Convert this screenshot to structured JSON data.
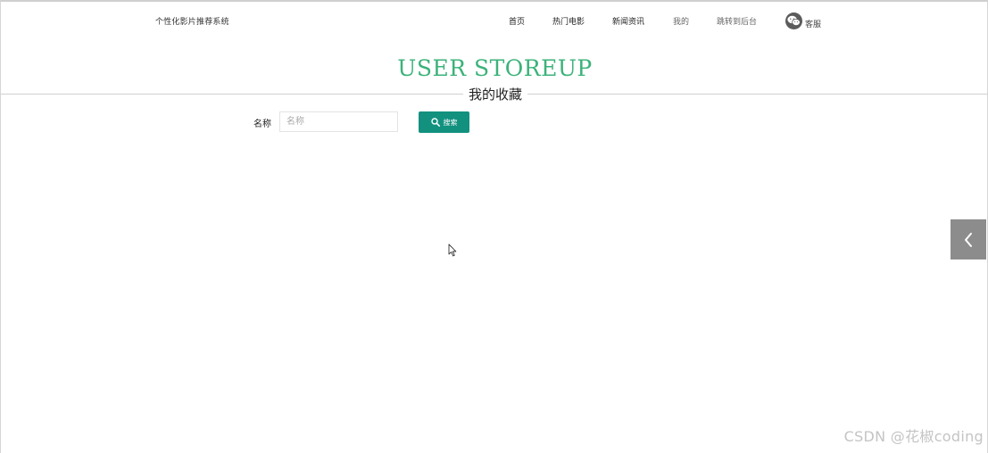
{
  "header": {
    "site_name": "个性化影片推荐系统",
    "nav": [
      {
        "label": "首页"
      },
      {
        "label": "热门电影"
      },
      {
        "label": "新闻资讯"
      },
      {
        "label": "我的"
      },
      {
        "label": "跳转到后台"
      }
    ],
    "service_label": "客服",
    "service_icon": "wechat-icon"
  },
  "main": {
    "title": "USER STOREUP",
    "subtitle": "我的收藏",
    "title_color": "#3bb27a",
    "search": {
      "label": "名称",
      "placeholder": "名称",
      "value": "",
      "button_label": "搜索",
      "button_icon": "search-icon",
      "button_color": "#12917f"
    }
  },
  "side_tab": {
    "icon": "chevron-left-icon"
  },
  "watermark": "CSDN @花椒coding"
}
